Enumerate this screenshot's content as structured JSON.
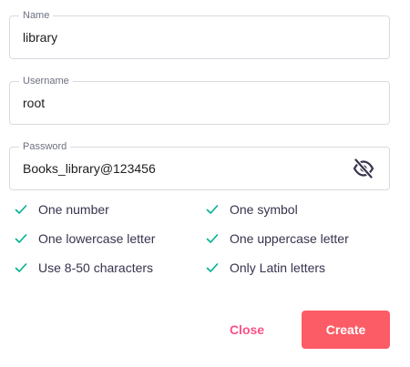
{
  "form": {
    "name": {
      "label": "Name",
      "value": "library"
    },
    "username": {
      "label": "Username",
      "value": "root"
    },
    "password": {
      "label": "Password",
      "value": "Books_library@123456",
      "visibility_icon": "eye-slash-icon"
    }
  },
  "requirements": [
    {
      "label": "One number",
      "met": true
    },
    {
      "label": "One symbol",
      "met": true
    },
    {
      "label": "One lowercase letter",
      "met": true
    },
    {
      "label": "One uppercase letter",
      "met": true
    },
    {
      "label": "Use 8-50 characters",
      "met": true
    },
    {
      "label": "Only Latin letters",
      "met": true
    }
  ],
  "actions": {
    "close_label": "Close",
    "create_label": "Create"
  },
  "colors": {
    "accent": "#fc5c65",
    "check": "#00b090",
    "border": "#d8dae0"
  }
}
